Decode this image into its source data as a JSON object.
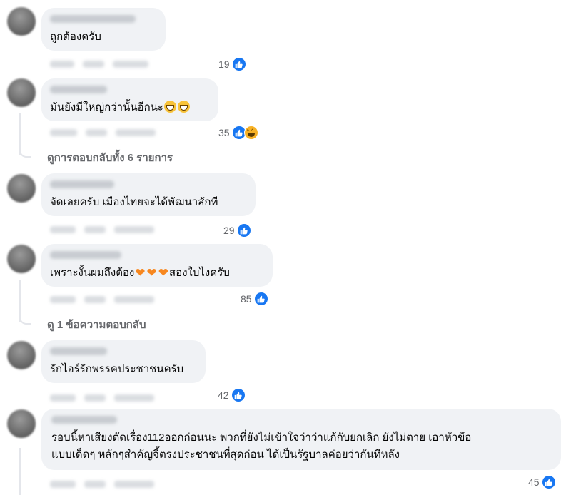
{
  "comments": [
    {
      "text": "ถูกต้องครับ",
      "likes": "19"
    },
    {
      "text": "มันยังมีใหญ่กว่านั้นอีกนะ",
      "likes": "35"
    },
    {
      "text": "จัดเลยครับ เมืองไทยจะได้พัฒนาสักที",
      "likes": "29"
    },
    {
      "text_before": "เพราะงั้นผมถึงต้อง",
      "text_after": "สองใบไงครับ",
      "likes": "85"
    },
    {
      "text": "รักไอร์รักพรรคประชาชนครับ",
      "likes": "42"
    },
    {
      "line1": "รอบนี้หาเสียงตัดเรื่อง112ออกก่อนนะ พวกที่ยังไม่เข้าใจว่าว่าแก้กับยกเลิก ยังไม่ตาย เอาหัวข้อ",
      "line2": "แบบเด็ดๆ หลักๆสำคัญจี้ตรงประชาชนที่สุดก่อน ได้เป็นรัฐบาลค่อยว่ากันทีหลัง",
      "likes": "45"
    }
  ],
  "reply_links": [
    {
      "label": "ดูการตอบกลับทั้ง 6 รายการ"
    },
    {
      "label": "ดู 1 ข้อความตอบกลับ"
    }
  ],
  "icons": {
    "like": "like-reaction-icon",
    "haha": "haha-reaction-icon",
    "grin": "grinning-face-emoji",
    "heart": "orange-heart-emoji"
  },
  "colors": {
    "bubble": "#f0f2f5",
    "like_blue": "#1877f2",
    "muted": "#65676b"
  }
}
